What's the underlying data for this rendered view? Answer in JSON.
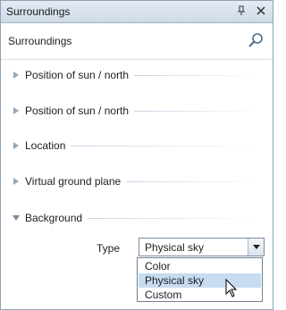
{
  "window": {
    "title": "Surroundings",
    "pin_icon": "pin-icon",
    "close_icon": "close-icon"
  },
  "header": {
    "label": "Surroundings",
    "search_icon": "search-icon"
  },
  "sections": [
    {
      "label": "Position of sun / north",
      "expanded": false
    },
    {
      "label": "Position of sun / north",
      "expanded": false
    },
    {
      "label": "Location",
      "expanded": false
    },
    {
      "label": "Virtual ground plane",
      "expanded": false
    },
    {
      "label": "Background",
      "expanded": true
    }
  ],
  "background": {
    "type_label": "Type",
    "selected": "Physical sky",
    "options": [
      "Color",
      "Physical sky",
      "Custom"
    ],
    "highlighted_index": 1
  },
  "colors": {
    "titlebar": "#cfdae7",
    "accent_rule": "#c8d6e6",
    "selection": "#c7dcf1"
  }
}
